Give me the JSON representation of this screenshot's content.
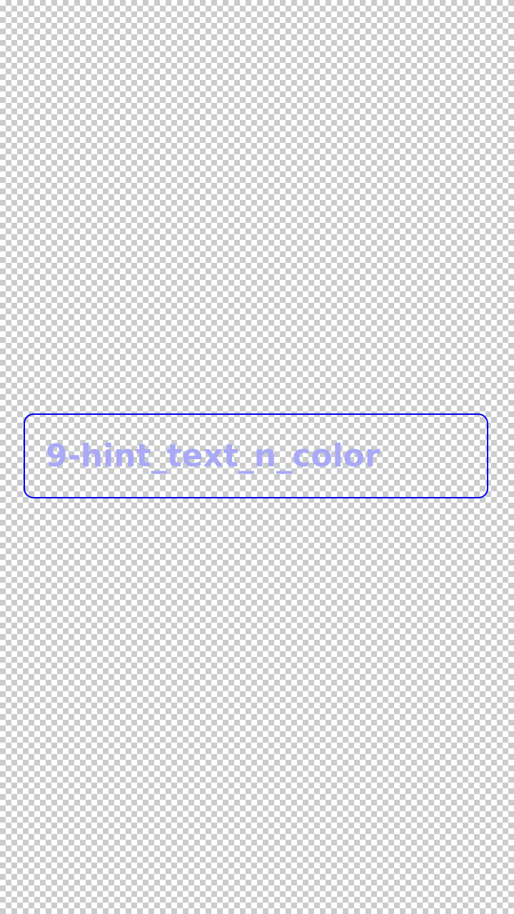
{
  "text_field": {
    "value": "",
    "placeholder": "9-hint_text_n_color",
    "border_color": "#0000ee",
    "hint_color": "#a9a9f7"
  },
  "background": {
    "pattern": "transparency-checkerboard"
  }
}
